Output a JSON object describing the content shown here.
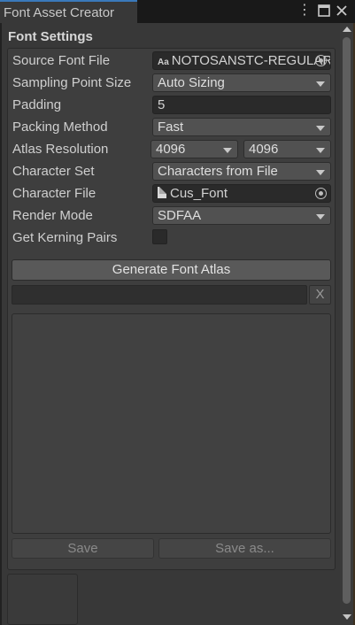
{
  "window": {
    "tab_title": "Font Asset Creator",
    "menu_icon": "more-vert-icon",
    "maximize_icon": "maximize-icon",
    "close_icon": "close-icon"
  },
  "section": {
    "title": "Font Settings"
  },
  "fields": {
    "source_font_file": {
      "label": "Source Font File",
      "value": "NOTOSANSTC-REGULAR",
      "icon": "font-asset-icon"
    },
    "sampling_point_size": {
      "label": "Sampling Point Size",
      "value": "Auto Sizing"
    },
    "padding": {
      "label": "Padding",
      "value": "5"
    },
    "packing_method": {
      "label": "Packing Method",
      "value": "Fast"
    },
    "atlas_resolution": {
      "label": "Atlas Resolution",
      "width": "4096",
      "height": "4096"
    },
    "character_set": {
      "label": "Character Set",
      "value": "Characters from File"
    },
    "character_file": {
      "label": "Character File",
      "value": "Cus_Font",
      "icon": "text-file-icon"
    },
    "render_mode": {
      "label": "Render Mode",
      "value": "SDFAA"
    },
    "get_kerning_pairs": {
      "label": "Get Kerning Pairs",
      "checked": false
    }
  },
  "buttons": {
    "generate": "Generate Font Atlas",
    "clear": "X",
    "save": "Save",
    "save_as": "Save as..."
  },
  "colors": {
    "accent": "#3a79bb",
    "background": "#383838"
  }
}
